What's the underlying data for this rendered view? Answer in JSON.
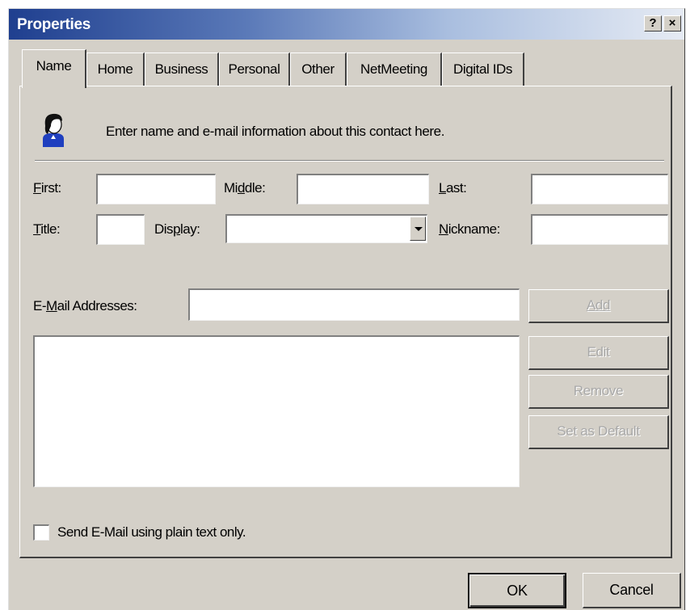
{
  "window": {
    "title": "Properties"
  },
  "caption_buttons": {
    "help": "?",
    "close": "×"
  },
  "tabs": [
    {
      "label": "Name",
      "active": true
    },
    {
      "label": "Home"
    },
    {
      "label": "Business"
    },
    {
      "label": "Personal"
    },
    {
      "label": "Other"
    },
    {
      "label": "NetMeeting"
    },
    {
      "label": "Digital IDs"
    }
  ],
  "intro_text": "Enter name and e-mail information about this contact here.",
  "fields": {
    "first": {
      "label": "First:",
      "value": ""
    },
    "middle": {
      "label": "Middle:",
      "value": ""
    },
    "last": {
      "label": "Last:",
      "value": ""
    },
    "title": {
      "label": "Title:",
      "value": ""
    },
    "display": {
      "label": "Display:",
      "value": ""
    },
    "nickname": {
      "label": "Nickname:",
      "value": ""
    }
  },
  "email": {
    "label": "E-Mail Addresses:",
    "value": ""
  },
  "email_buttons": {
    "add": "Add",
    "edit": "Edit",
    "remove": "Remove",
    "set_default": "Set as Default"
  },
  "plain_text_checkbox": {
    "label": "Send E-Mail using plain text only.",
    "checked": false
  },
  "dialog_buttons": {
    "ok": "OK",
    "cancel": "Cancel"
  },
  "colors": {
    "face": "#d4d0c8",
    "title_start": "#1f3f8f",
    "title_end": "#e6ebf4",
    "disabled_text": "#a8a8a8"
  },
  "icons": {
    "contact": "person-icon",
    "dropdown": "chevron-down-icon"
  }
}
